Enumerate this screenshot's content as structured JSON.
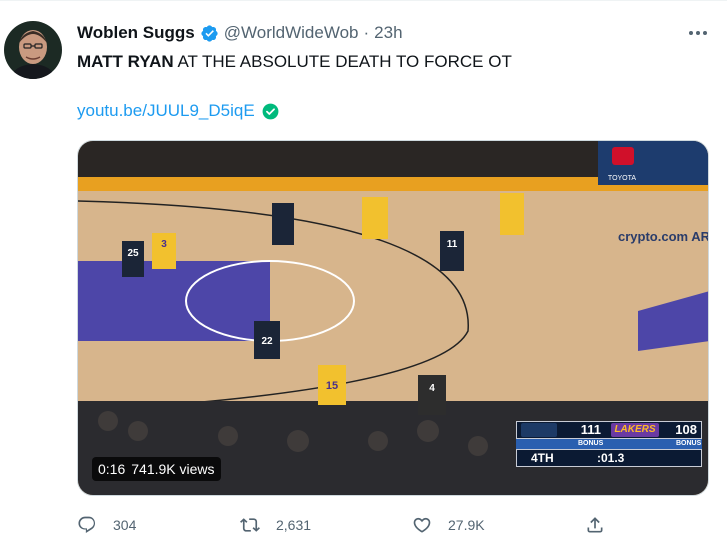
{
  "tweet": {
    "display_name": "Woblen Suggs",
    "handle": "@WorldWideWob",
    "separator": "·",
    "time": "23h",
    "text_bold": "MATT RYAN",
    "text_rest": " AT THE ABSOLUTE DEATH TO FORCE OT",
    "link": "youtu.be/JUUL9_D5iqE",
    "verified_color": "#1d9bf0",
    "link_check_color": "#00ba7c"
  },
  "media": {
    "duration": "0:16",
    "views": "741.9K views",
    "scoreboard": {
      "home_score": "111",
      "away_team": "LAKERS",
      "away_score": "108",
      "bonus_label": "BONUS",
      "quarter": "4TH",
      "clock": ":01.3"
    },
    "arena_text": "crypto.com ARENA",
    "sponsor": "TOYOTA",
    "jerseys": [
      "3",
      "25",
      "22",
      "11",
      "15",
      "4"
    ]
  },
  "actions": {
    "replies": "304",
    "retweets": "2,631",
    "likes": "27.9K"
  },
  "icons": {
    "more": "more-icon",
    "reply": "reply-icon",
    "retweet": "retweet-icon",
    "like": "heart-icon",
    "share": "share-icon"
  }
}
